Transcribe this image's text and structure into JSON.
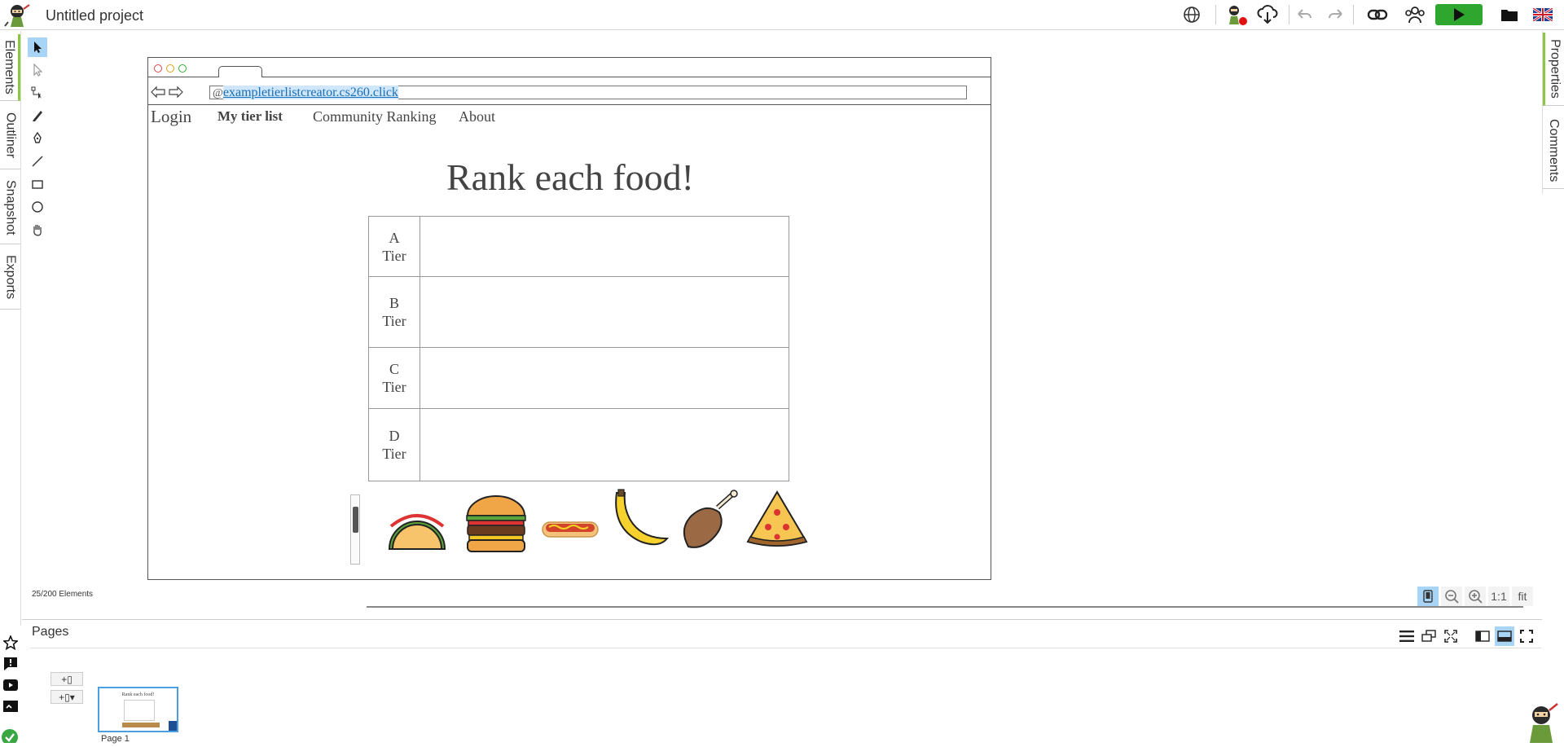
{
  "app": {
    "project_title": "Untitled project",
    "colors": {
      "accent_green": "#2fa72f",
      "selection_blue": "#a8d4f5",
      "tab_marker": "#8dc63f"
    }
  },
  "toolbar": {
    "icons": [
      "globe-icon",
      "ninja-record-icon",
      "cloud-download-icon",
      "undo-icon",
      "redo-icon",
      "link-icon",
      "collaborators-icon",
      "play-button",
      "folder-icon",
      "flag-uk-icon"
    ]
  },
  "left_tabs": [
    "Elements",
    "Outliner",
    "Snapshot",
    "Exports"
  ],
  "right_tabs": [
    "Properties",
    "Comments"
  ],
  "tools": [
    "pointer-tool",
    "direct-select-tool",
    "path-edit-tool",
    "pencil-tool",
    "pen-tool",
    "line-tool",
    "rectangle-tool",
    "ellipse-tool",
    "hand-tool"
  ],
  "mockup": {
    "url": "exampletierlistcreator.cs260.click",
    "url_prefix": "@",
    "nav": {
      "login": "Login",
      "my_tier_list": "My tier list",
      "community": "Community Ranking",
      "about": "About"
    },
    "heading": "Rank each food!",
    "tiers": [
      {
        "letter": "A",
        "word": "Tier"
      },
      {
        "letter": "B",
        "word": "Tier"
      },
      {
        "letter": "C",
        "word": "Tier"
      },
      {
        "letter": "D",
        "word": "Tier"
      }
    ],
    "foods": [
      "taco",
      "burger",
      "hotdog",
      "banana",
      "drumstick",
      "pizza"
    ]
  },
  "status": {
    "elements_count": "25/200 Elements"
  },
  "zoom": {
    "one_to_one": "1:1",
    "fit": "fit"
  },
  "pages": {
    "title": "Pages",
    "page1_caption": "Page 1",
    "add_page": "+▯",
    "add_page_menu": "+▯▾",
    "thumb_heading": "Rank each food!"
  }
}
